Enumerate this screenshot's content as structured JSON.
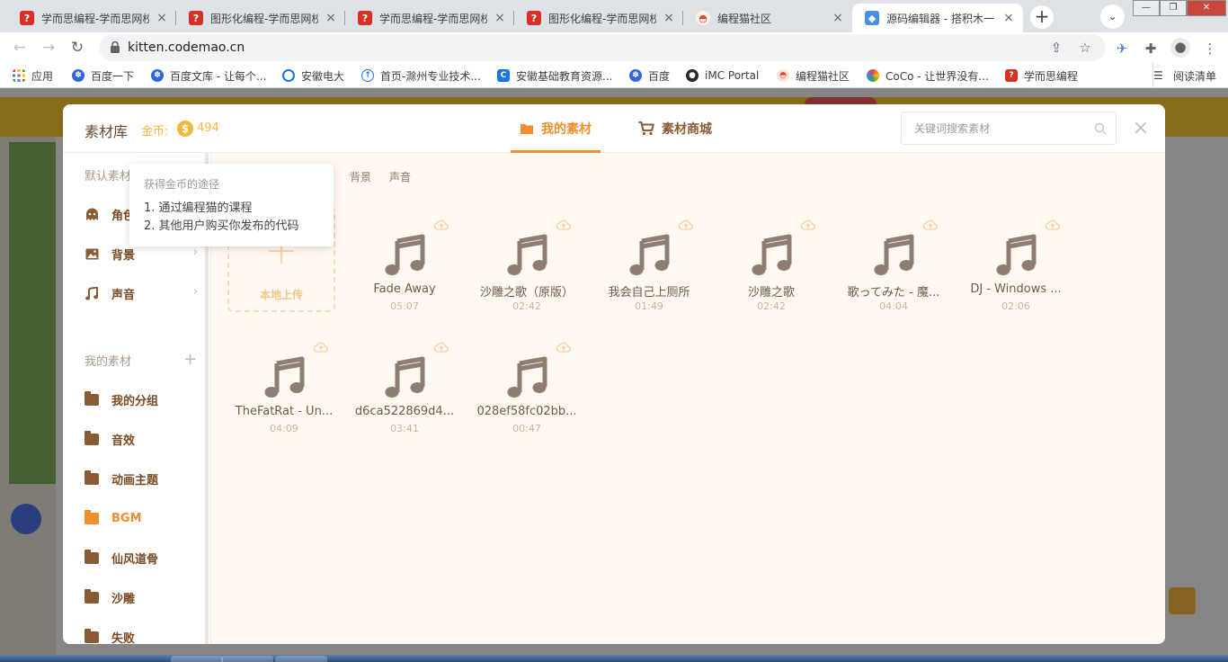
{
  "browser": {
    "tabs": [
      {
        "title": "学而思编程-学而思网校",
        "favicon": "question-icon"
      },
      {
        "title": "图形化编程-学而思网校",
        "favicon": "question-icon"
      },
      {
        "title": "学而思编程-学而思网校",
        "favicon": "question-icon"
      },
      {
        "title": "图形化编程-学而思网校",
        "favicon": "question-icon"
      },
      {
        "title": "编程猫社区",
        "favicon": "codemao-icon"
      },
      {
        "title": "源码编辑器 - 搭积木一",
        "favicon": "kitten-icon"
      }
    ],
    "new_tab": "+",
    "address": "kitten.codemao.cn",
    "bookmarks": [
      {
        "label": "应用",
        "icon": "apps-icon"
      },
      {
        "label": "百度一下",
        "icon": "baidu-icon"
      },
      {
        "label": "百度文库 - 让每个...",
        "icon": "baidu-icon"
      },
      {
        "label": "安徽电大",
        "icon": "ie-icon"
      },
      {
        "label": "首页-滁州专业技术...",
        "icon": "upload-icon"
      },
      {
        "label": "安徽基础教育资源...",
        "icon": "c-icon"
      },
      {
        "label": "百度",
        "icon": "baidu-icon"
      },
      {
        "label": "iMC Portal",
        "icon": "github-icon"
      },
      {
        "label": "编程猫社区",
        "icon": "codemao-icon"
      },
      {
        "label": "CoCo - 让世界没有...",
        "icon": "coco-icon"
      },
      {
        "label": "学而思编程",
        "icon": "question-icon"
      }
    ],
    "reading_list": "阅读清单",
    "colors": {
      "tab_strip": "#dee1e6",
      "question_favicon": "#d93025"
    }
  },
  "modal": {
    "title": "素材库",
    "coins_label": "金币:",
    "coin_symbol": "$",
    "coins": "494",
    "tabs": [
      {
        "label": "我的素材",
        "icon": "folder-icon",
        "active": true
      },
      {
        "label": "素材商城",
        "icon": "cart-icon",
        "active": false
      }
    ],
    "search_placeholder": "关键词搜索素材",
    "close": "×",
    "sidebar": {
      "default_section": "默认素材",
      "default_items": [
        {
          "label": "角色",
          "icon": "ghost-icon"
        },
        {
          "label": "背景",
          "icon": "image-icon"
        },
        {
          "label": "声音",
          "icon": "music-icon"
        }
      ],
      "my_section": "我的素材",
      "my_add": "+",
      "my_items": [
        {
          "label": "我的分组",
          "active": false
        },
        {
          "label": "音效",
          "active": false
        },
        {
          "label": "动画主题",
          "active": false
        },
        {
          "label": "BGM",
          "active": true
        },
        {
          "label": "仙风道骨",
          "active": false
        },
        {
          "label": "沙雕",
          "active": false
        },
        {
          "label": "失败",
          "active": false
        }
      ]
    },
    "sub_tabs": [
      "背景",
      "声音"
    ],
    "upload_label": "本地上传",
    "sounds": [
      {
        "name": "Fade Away",
        "duration": "05:07"
      },
      {
        "name": "沙雕之歌（原版）",
        "duration": "02:42"
      },
      {
        "name": "我会自己上厕所",
        "duration": "01:49"
      },
      {
        "name": "沙雕之歌",
        "duration": "02:42"
      },
      {
        "name": "歌ってみた - 魔...",
        "duration": "04:04"
      },
      {
        "name": "DJ - Windows ...",
        "duration": "02:06"
      },
      {
        "name": "TheFatRat - Un...",
        "duration": "04:09"
      },
      {
        "name": "d6ca522869d4...",
        "duration": "03:41"
      },
      {
        "name": "028ef58fc02bb...",
        "duration": "00:47"
      }
    ],
    "tooltip": {
      "title": "获得金币的途径",
      "lines": [
        "1. 通过编程猫的课程",
        "2. 其他用户购买你发布的代码"
      ]
    },
    "colors": {
      "accent": "#f08d2f",
      "brown": "#7a4a24",
      "coin": "#f6b73c",
      "content_bg": "#fff9f2",
      "note": "#8e7d72"
    }
  }
}
